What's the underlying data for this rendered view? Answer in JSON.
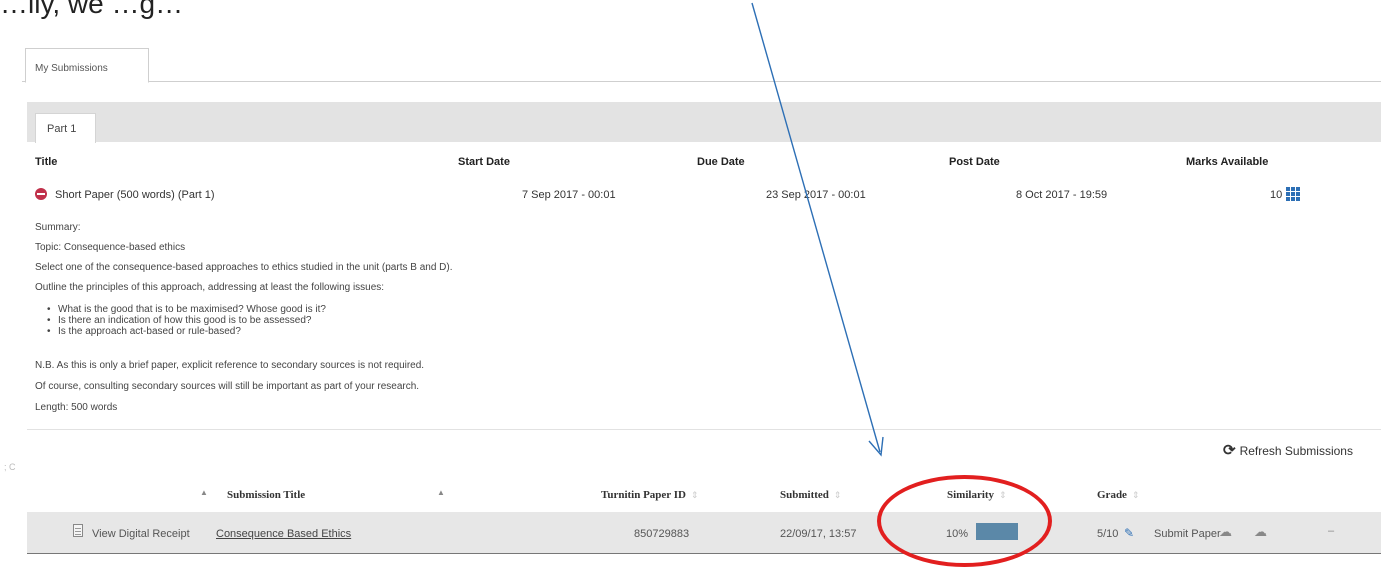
{
  "tabs": {
    "outer": "My Submissions",
    "inner": "Part 1"
  },
  "assignment": {
    "headers": {
      "title": "Title",
      "start": "Start Date",
      "due": "Due Date",
      "post": "Post Date",
      "marks": "Marks Available"
    },
    "title": "Short Paper (500 words) (Part 1)",
    "start": "7 Sep 2017 - 00:01",
    "due": "23 Sep 2017 - 00:01",
    "post": "8 Oct 2017 - 19:59",
    "marks": "10"
  },
  "summary": {
    "label": "Summary:",
    "topic": "Topic: Consequence-based ethics",
    "line1": "Select one of the consequence-based approaches to ethics studied in the unit (parts B and D).",
    "line2": "Outline the principles of this approach, addressing at least the following issues:",
    "bullets": [
      "What is the good that is to be maximised?  Whose good is it?",
      "Is there an indication of how this good is to be assessed?",
      "Is the approach act-based or rule-based?"
    ],
    "nb": "N.B. As this is only a brief paper, explicit reference to secondary sources is not required.",
    "course": "Of course, consulting secondary sources will still be important as part of your research.",
    "length": "Length:  500 words"
  },
  "refresh_label": "Refresh Submissions",
  "table": {
    "headers": {
      "title": "Submission Title",
      "paper_id": "Turnitin Paper ID",
      "submitted": "Submitted",
      "similarity": "Similarity",
      "grade": "Grade"
    },
    "row": {
      "receipt": "View Digital Receipt",
      "title": "Consequence Based Ethics",
      "paper_id": "850729883",
      "submitted": "22/09/17, 13:57",
      "similarity": "10%",
      "grade": "5/10",
      "submit": "Submit Paper"
    }
  },
  "icons": {
    "status": "minus-circle-icon",
    "marks": "grid-icon",
    "refresh": "refresh-icon",
    "receipt": "document-icon",
    "edit": "pencil-icon",
    "cloud": "cloud-upload-icon"
  },
  "colors": {
    "accent": "#2d6fb5",
    "annotation": "#e21f1f",
    "similarity_bar": "#5b88a8"
  }
}
